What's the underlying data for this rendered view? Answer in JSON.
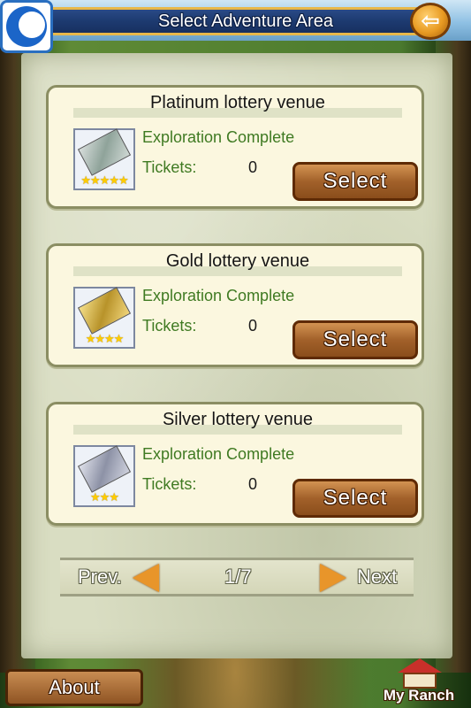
{
  "header": {
    "title": "Select Adventure Area",
    "back_icon": "arrow-left-icon",
    "app_icon": "app-logo-icon"
  },
  "venues": [
    {
      "name": "Platinum lottery venue",
      "status": "Exploration Complete",
      "tickets_label": "Tickets:",
      "tickets_count": "0",
      "stars": "★★★★★",
      "star_count": 5,
      "ticket_type": "platinum",
      "select_label": "Select"
    },
    {
      "name": "Gold lottery venue",
      "status": "Exploration Complete",
      "tickets_label": "Tickets:",
      "tickets_count": "0",
      "stars": "★★★★",
      "star_count": 4,
      "ticket_type": "gold",
      "select_label": "Select"
    },
    {
      "name": "Silver lottery venue",
      "status": "Exploration Complete",
      "tickets_label": "Tickets:",
      "tickets_count": "0",
      "stars": "★★★",
      "star_count": 3,
      "ticket_type": "silver",
      "select_label": "Select"
    }
  ],
  "pager": {
    "prev_label": "Prev.",
    "next_label": "Next",
    "page_indicator": "1/7"
  },
  "footer": {
    "about_label": "About",
    "ranch_label": "My Ranch",
    "ranch_icon": "barn-icon"
  },
  "colors": {
    "title_bar": "#1d3a70",
    "accent_gold": "#e8b84a",
    "status_green": "#3f7a22",
    "button_brown": "#a2612a",
    "parchment": "#d9ddc2"
  }
}
